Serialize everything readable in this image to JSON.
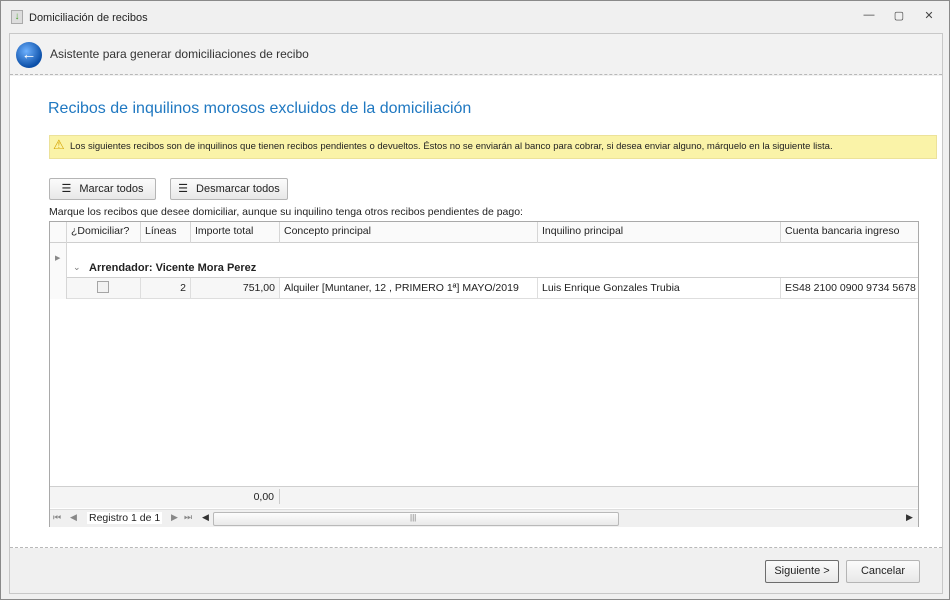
{
  "window": {
    "title": "Domiciliación de recibos",
    "minimize": "—",
    "restore": "▢",
    "close": "✕"
  },
  "header": {
    "title": "Asistente para generar domiciliaciones de recibo"
  },
  "main": {
    "heading": "Recibos de inquilinos morosos excluidos de la domiciliación",
    "warning": "Los siguientes recibos son de inquilinos que tienen recibos pendientes o devueltos. Éstos no se enviarán al banco para cobrar, si desea enviar alguno, márquelo en la siguiente lista.",
    "mark_all": "Marcar todos",
    "unmark_all": "Desmarcar todos",
    "instruction": "Marque los recibos que desee domiciliar, aunque su inquilino tenga otros recibos pendientes de pago:"
  },
  "grid": {
    "columns": [
      "¿Domiciliar?",
      "Líneas",
      "Importe total",
      "Concepto principal",
      "Inquilino principal",
      "Cuenta bancaria ingreso"
    ],
    "group": "Arrendador: Vicente Mora Perez",
    "rows": [
      {
        "domiciliar": false,
        "lineas": "2",
        "importe": "751,00",
        "concepto": "Alquiler [Muntaner, 12 , PRIMERO 1ª] MAYO/2019",
        "inquilino": "Luis Enrique Gonzales Trubia",
        "cuenta": "ES48 2100 0900 9734 5678"
      }
    ],
    "total": "0,00",
    "record": "Registro 1 de 1"
  },
  "footer": {
    "next": "Siguiente >",
    "cancel": "Cancelar"
  }
}
